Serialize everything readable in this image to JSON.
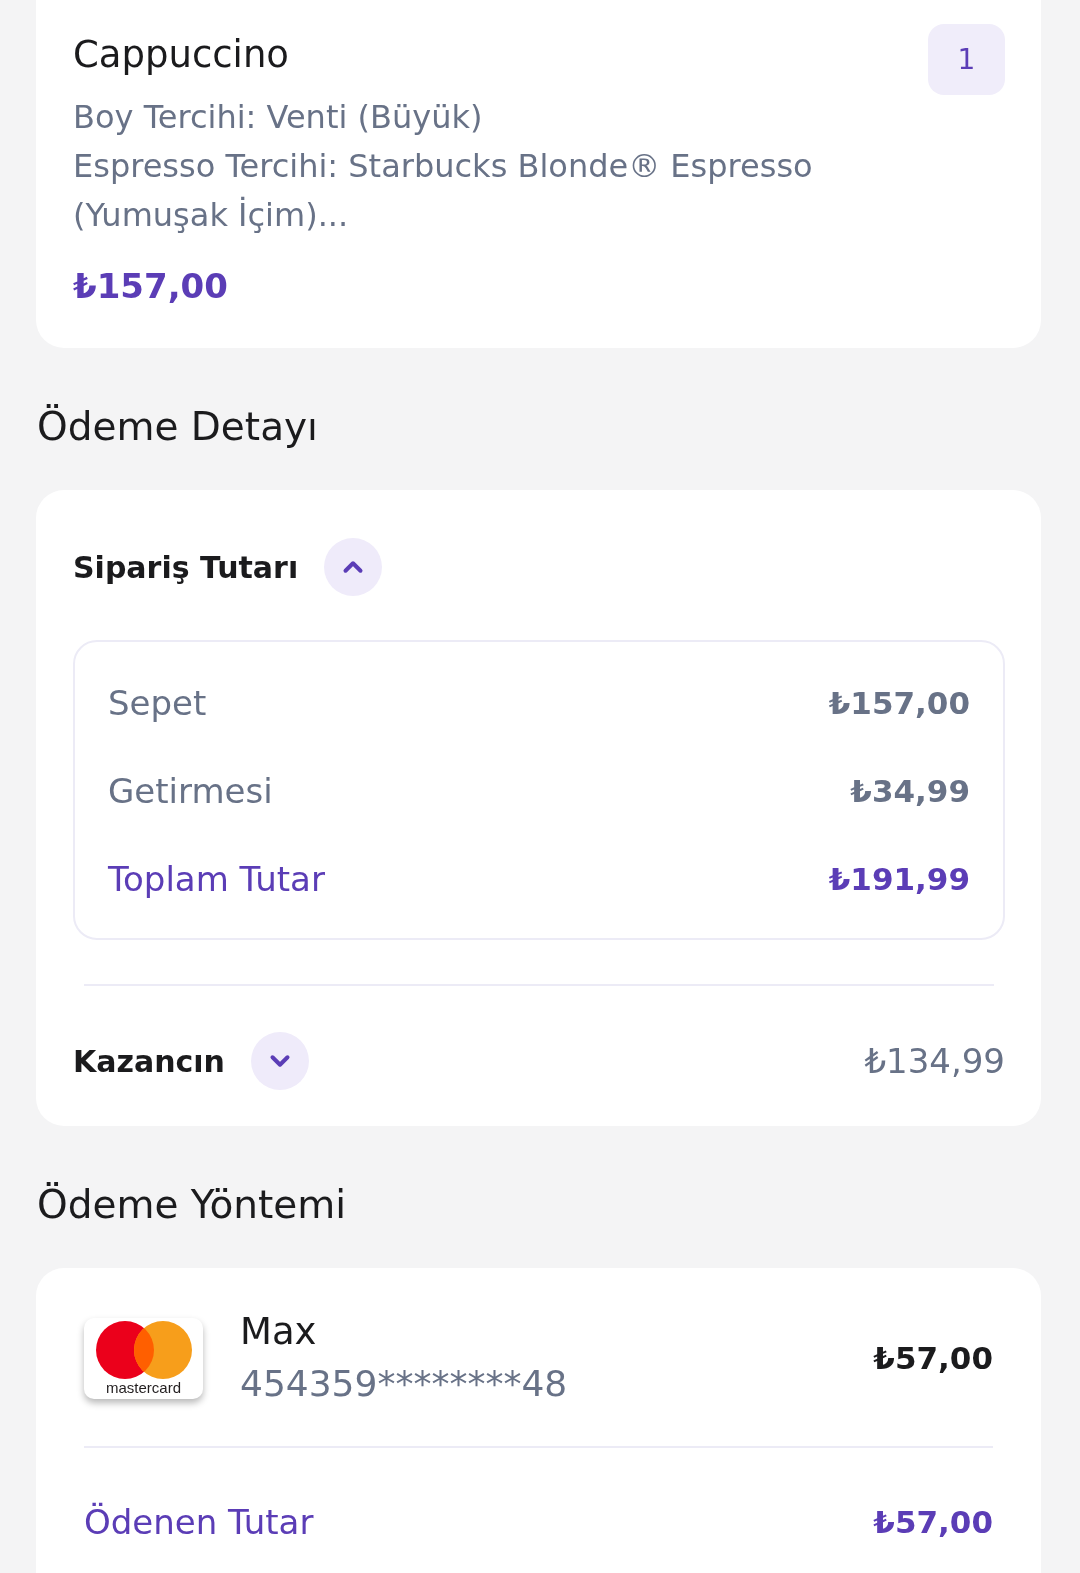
{
  "order_item": {
    "name": "Cappuccino",
    "quantity": "1",
    "options": [
      "Boy Tercihi: Venti (Büyük)",
      "Espresso Tercihi: Starbucks Blonde® Espresso (Yumuşak İçim)..."
    ],
    "price": "₺157,00"
  },
  "payment_detail": {
    "heading": "Ödeme Detayı",
    "sections": [
      {
        "label": "Sipariş Tutarı",
        "expanded": true,
        "rows": [
          {
            "kind": "line",
            "label": "Sepet",
            "value": "₺157,00"
          },
          {
            "kind": "line",
            "label": "Getirmesi",
            "value": "₺34,99"
          },
          {
            "kind": "total",
            "label": "Toplam Tutar",
            "value": "₺191,99"
          }
        ]
      },
      {
        "label": "Kazancın",
        "expanded": false,
        "value": "₺134,99"
      }
    ]
  },
  "payment_method": {
    "heading": "Ödeme Yöntemi",
    "cards": [
      {
        "brand": "mastercard",
        "name": "Max",
        "number": "454359********48",
        "amount": "₺57,00"
      }
    ],
    "paid": {
      "label": "Ödenen Tutar",
      "value": "₺57,00"
    }
  }
}
